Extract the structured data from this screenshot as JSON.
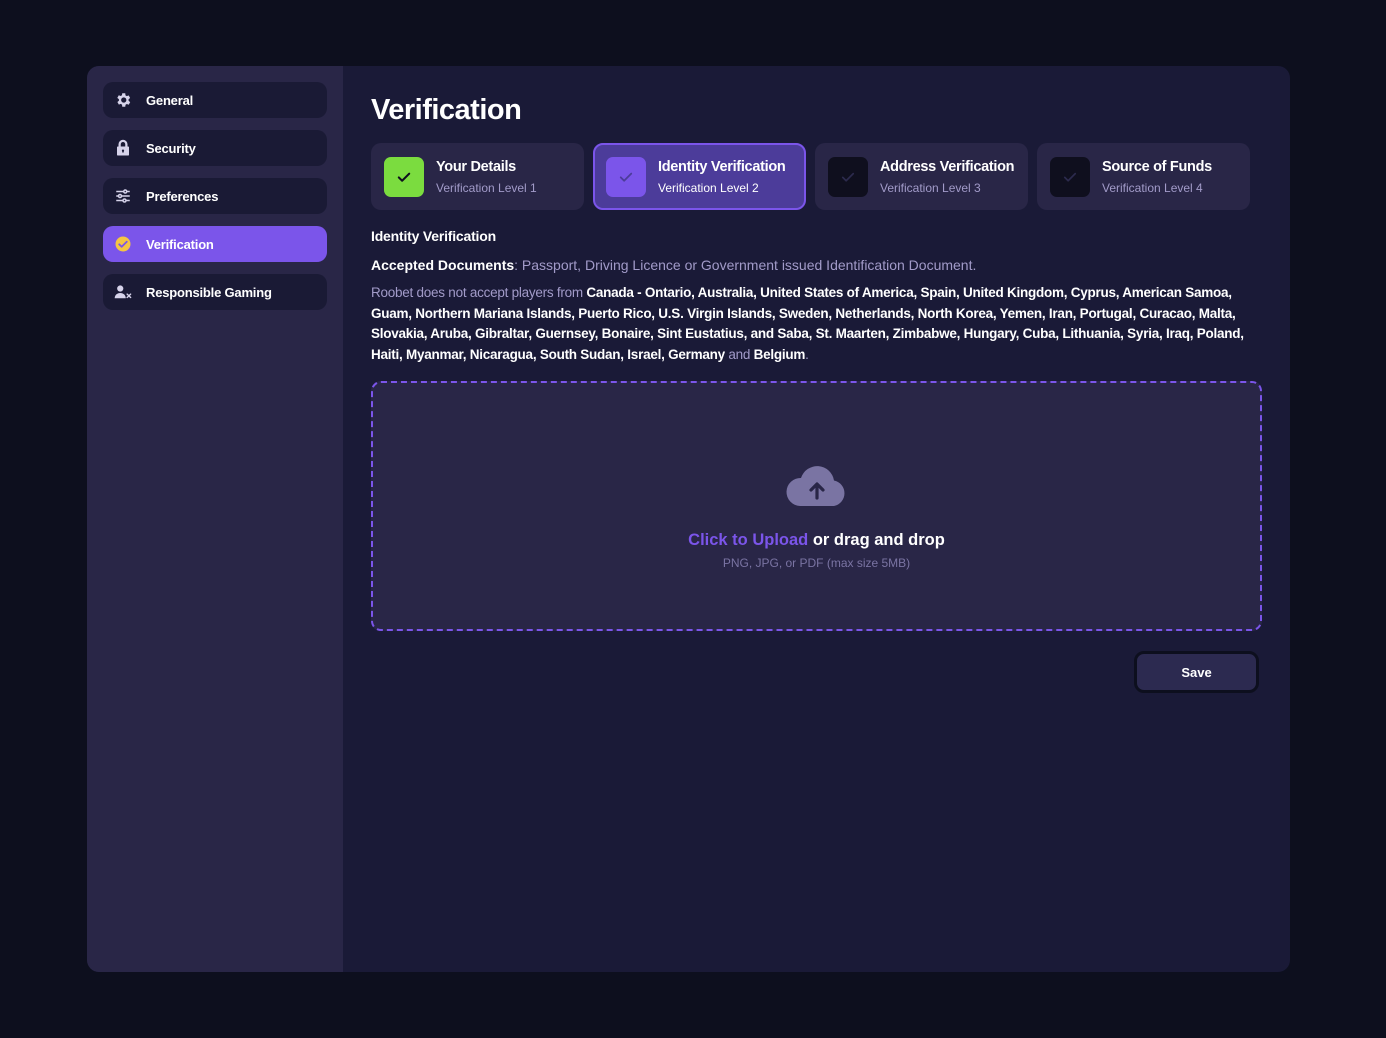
{
  "sidebar": {
    "items": [
      {
        "label": "General",
        "icon": "gear-icon"
      },
      {
        "label": "Security",
        "icon": "lock-icon"
      },
      {
        "label": "Preferences",
        "icon": "sliders-icon"
      },
      {
        "label": "Verification",
        "icon": "check-circle-icon",
        "active": true
      },
      {
        "label": "Responsible Gaming",
        "icon": "user-x-icon"
      }
    ]
  },
  "main": {
    "title": "Verification",
    "steps": [
      {
        "title": "Your Details",
        "sub": "Verification Level 1",
        "state": "done"
      },
      {
        "title": "Identity Verification",
        "sub": "Verification Level 2",
        "state": "current"
      },
      {
        "title": "Address Verification",
        "sub": "Verification Level 3",
        "state": "pending"
      },
      {
        "title": "Source of Funds",
        "sub": "Verification Level 4",
        "state": "pending"
      }
    ],
    "section_heading": "Identity Verification",
    "accepted_label": "Accepted Documents",
    "accepted_text": ": Passport, Driving Licence or Government issued Identification Document.",
    "notice_prefix": "Roobet does not accept players from ",
    "notice_countries": "Canada - Ontario, Australia, United States of America, Spain, United Kingdom, Cyprus, American Samoa, Guam, Northern Mariana Islands, Puerto Rico, U.S. Virgin Islands, Sweden, Netherlands, North Korea, Yemen, Iran, Portugal, Curacao, Malta, Slovakia, Aruba, Gibraltar, Guernsey, Bonaire, Sint Eustatius, and Saba, St. Maarten, Zimbabwe, Hungary, Cuba, Lithuania, Syria, Iraq, Poland, Haiti, Myanmar, Nicaragua, South Sudan, Israel, Germany",
    "notice_and": " and ",
    "notice_last": "Belgium",
    "notice_end": ".",
    "upload": {
      "link_text": "Click to Upload",
      "rest_text": " or drag and drop",
      "hint": "PNG, JPG, or PDF (max size 5MB)"
    },
    "save_label": "Save"
  },
  "colors": {
    "accent": "#7b55ea",
    "success": "#7bdc3f",
    "background": "#1a1a37",
    "panel": "#292647"
  }
}
